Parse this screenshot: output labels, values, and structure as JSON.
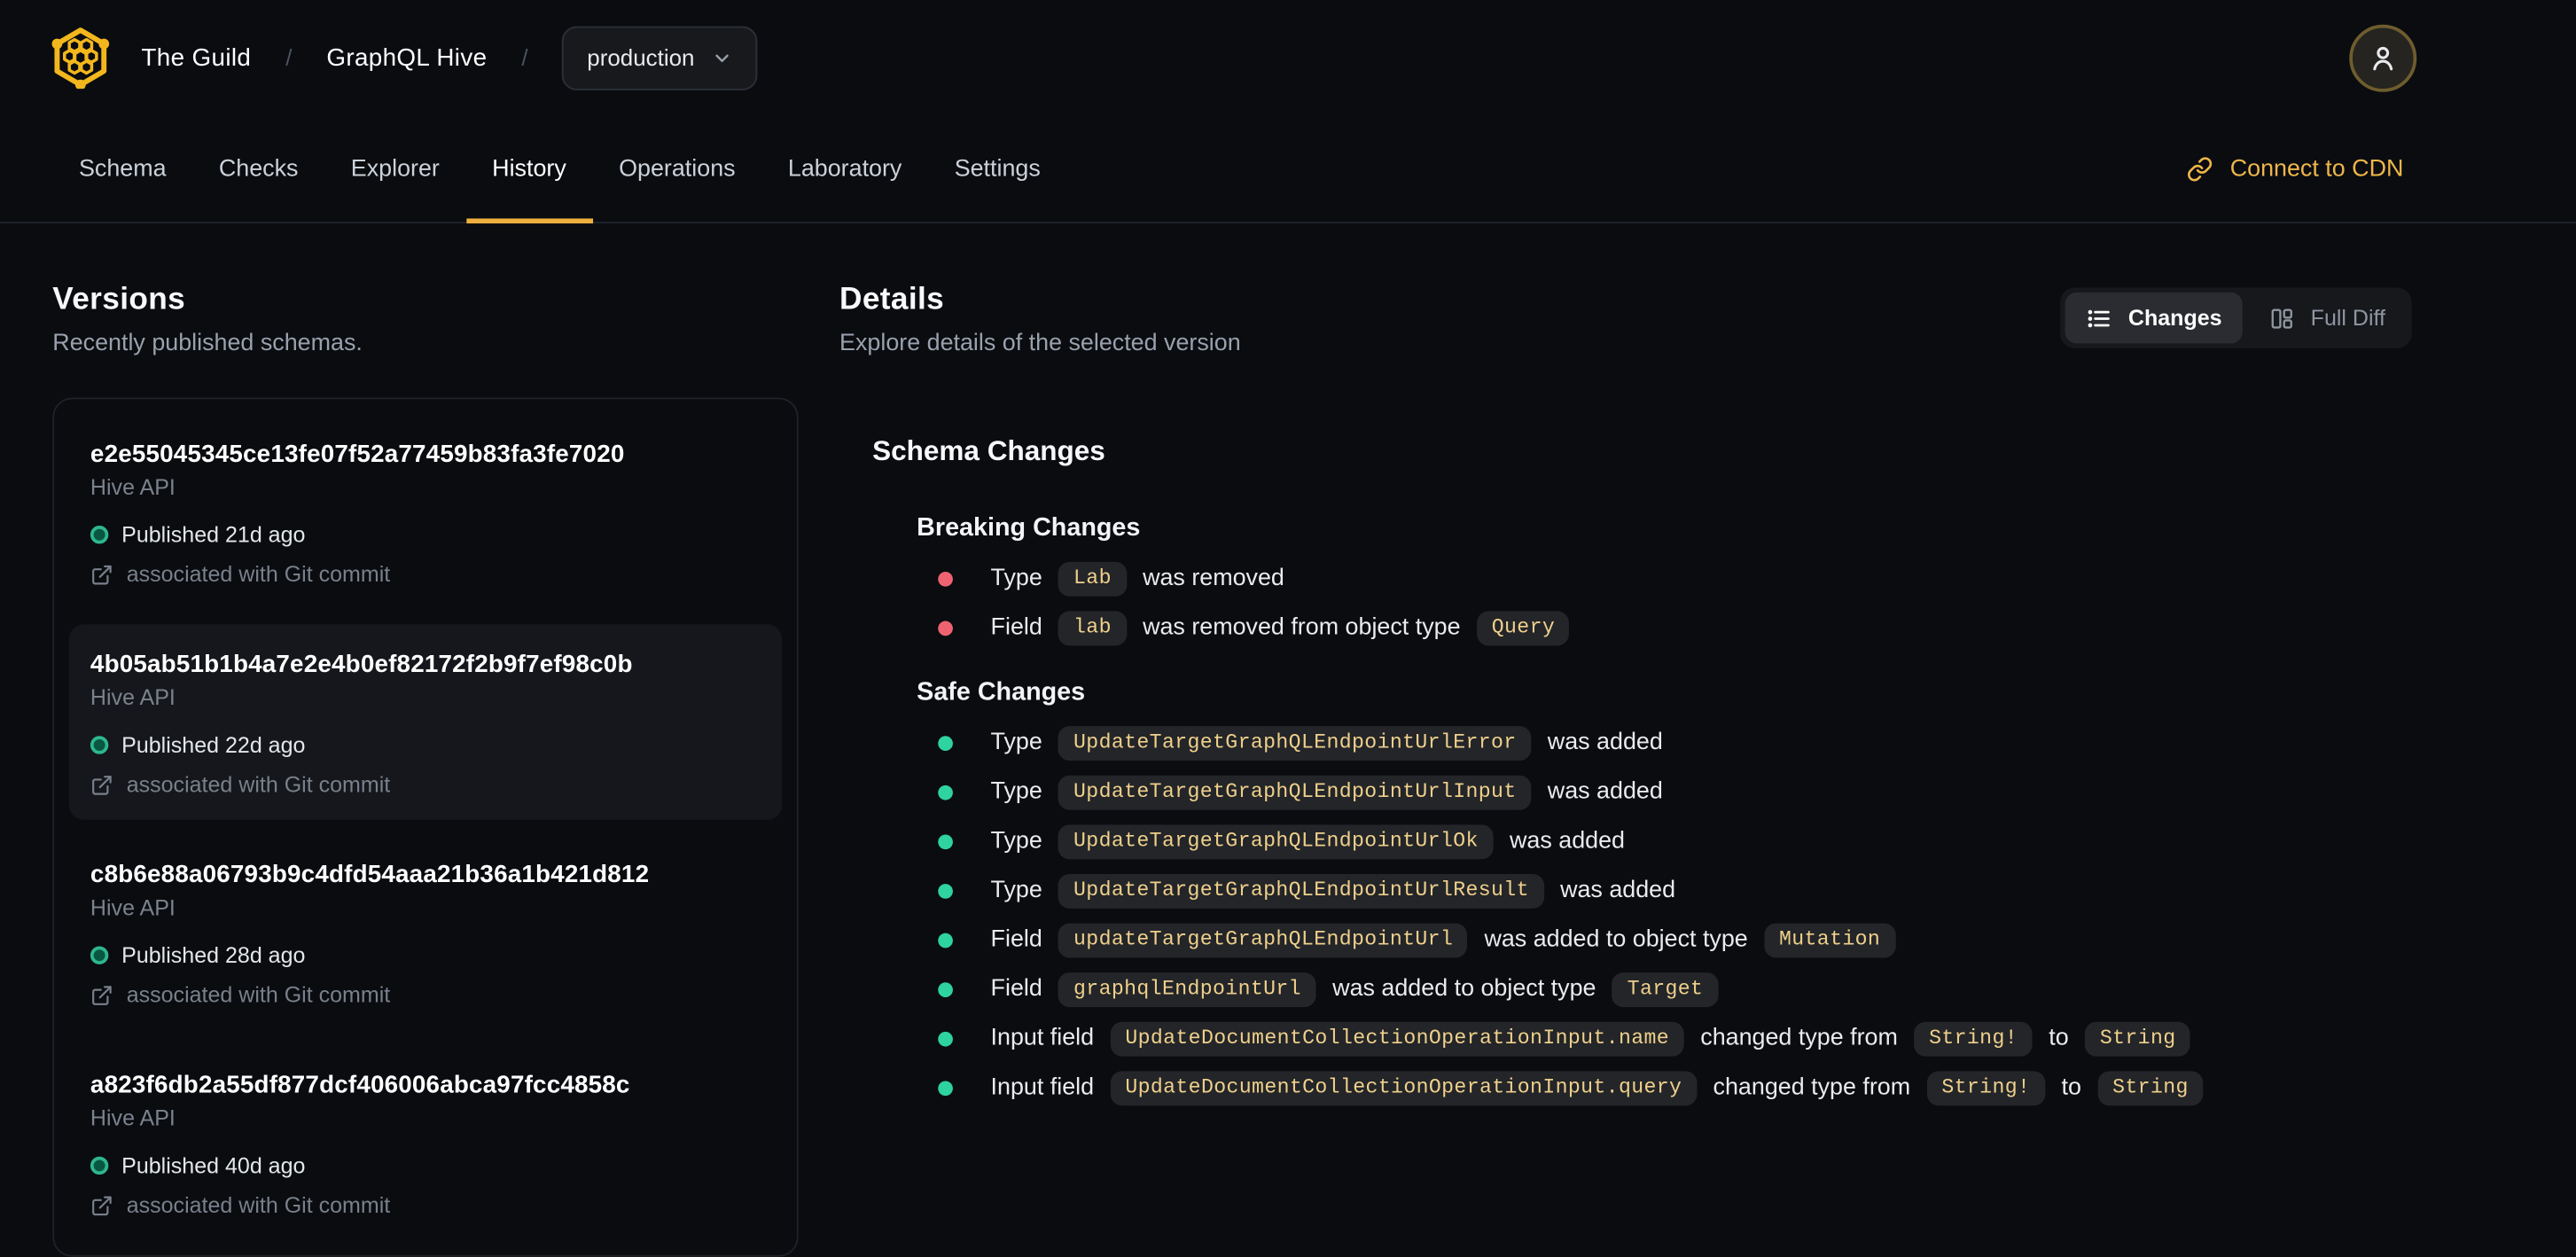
{
  "brand": {
    "org": "The Guild",
    "separator": "/",
    "project": "GraphQL Hive",
    "target": "production"
  },
  "nav": {
    "tabs": [
      {
        "label": "Schema",
        "active": false
      },
      {
        "label": "Checks",
        "active": false
      },
      {
        "label": "Explorer",
        "active": false
      },
      {
        "label": "History",
        "active": true
      },
      {
        "label": "Operations",
        "active": false
      },
      {
        "label": "Laboratory",
        "active": false
      },
      {
        "label": "Settings",
        "active": false
      }
    ],
    "cdn_label": "Connect to CDN"
  },
  "versions": {
    "title": "Versions",
    "subtitle": "Recently published schemas.",
    "items": [
      {
        "hash": "e2e55045345ce13fe07f52a77459b83fa3fe7020",
        "service": "Hive API",
        "published": "Published 21d ago",
        "git": "associated with Git commit",
        "selected": false
      },
      {
        "hash": "4b05ab51b1b4a7e2e4b0ef82172f2b9f7ef98c0b",
        "service": "Hive API",
        "published": "Published 22d ago",
        "git": "associated with Git commit",
        "selected": true
      },
      {
        "hash": "c8b6e88a06793b9c4dfd54aaa21b36a1b421d812",
        "service": "Hive API",
        "published": "Published 28d ago",
        "git": "associated with Git commit",
        "selected": false
      },
      {
        "hash": "a823f6db2a55df877dcf406006abca97fcc4858c",
        "service": "Hive API",
        "published": "Published 40d ago",
        "git": "associated with Git commit",
        "selected": false
      }
    ]
  },
  "details": {
    "title": "Details",
    "subtitle": "Explore details of the selected version",
    "view_toggle": {
      "changes_label": "Changes",
      "full_diff_label": "Full Diff"
    },
    "schema_changes_title": "Schema Changes",
    "breaking": {
      "title": "Breaking Changes",
      "items": [
        [
          {
            "kind": "text",
            "text": "Type"
          },
          {
            "kind": "code",
            "text": "Lab"
          },
          {
            "kind": "text",
            "text": "was removed"
          }
        ],
        [
          {
            "kind": "text",
            "text": "Field"
          },
          {
            "kind": "code",
            "text": "lab"
          },
          {
            "kind": "text",
            "text": "was removed from object type"
          },
          {
            "kind": "code",
            "text": "Query"
          }
        ]
      ]
    },
    "safe": {
      "title": "Safe Changes",
      "items": [
        [
          {
            "kind": "text",
            "text": "Type"
          },
          {
            "kind": "code",
            "text": "UpdateTargetGraphQLEndpointUrlError"
          },
          {
            "kind": "text",
            "text": "was added"
          }
        ],
        [
          {
            "kind": "text",
            "text": "Type"
          },
          {
            "kind": "code",
            "text": "UpdateTargetGraphQLEndpointUrlInput"
          },
          {
            "kind": "text",
            "text": "was added"
          }
        ],
        [
          {
            "kind": "text",
            "text": "Type"
          },
          {
            "kind": "code",
            "text": "UpdateTargetGraphQLEndpointUrlOk"
          },
          {
            "kind": "text",
            "text": "was added"
          }
        ],
        [
          {
            "kind": "text",
            "text": "Type"
          },
          {
            "kind": "code",
            "text": "UpdateTargetGraphQLEndpointUrlResult"
          },
          {
            "kind": "text",
            "text": "was added"
          }
        ],
        [
          {
            "kind": "text",
            "text": "Field"
          },
          {
            "kind": "code",
            "text": "updateTargetGraphQLEndpointUrl"
          },
          {
            "kind": "text",
            "text": "was added to object type"
          },
          {
            "kind": "code",
            "text": "Mutation"
          }
        ],
        [
          {
            "kind": "text",
            "text": "Field"
          },
          {
            "kind": "code",
            "text": "graphqlEndpointUrl"
          },
          {
            "kind": "text",
            "text": "was added to object type"
          },
          {
            "kind": "code",
            "text": "Target"
          }
        ],
        [
          {
            "kind": "text",
            "text": "Input field"
          },
          {
            "kind": "code",
            "text": "UpdateDocumentCollectionOperationInput.name"
          },
          {
            "kind": "text",
            "text": "changed type from"
          },
          {
            "kind": "code",
            "text": "String!"
          },
          {
            "kind": "text",
            "text": "to"
          },
          {
            "kind": "code",
            "text": "String"
          }
        ],
        [
          {
            "kind": "text",
            "text": "Input field"
          },
          {
            "kind": "code",
            "text": "UpdateDocumentCollectionOperationInput.query"
          },
          {
            "kind": "text",
            "text": "changed type from"
          },
          {
            "kind": "code",
            "text": "String!"
          },
          {
            "kind": "text",
            "text": "to"
          },
          {
            "kind": "code",
            "text": "String"
          }
        ]
      ]
    }
  },
  "icons": {
    "logo": "hive-hexagon-logo",
    "target_chevron": "chevron-down",
    "avatar": "user-person",
    "cdn": "chain-link",
    "published": "status-dot",
    "git": "external-link",
    "changes_view": "bullet-list",
    "full_diff_view": "split-columns"
  },
  "colors": {
    "background": "#0a0c10",
    "accent_amber": "#f0b03f",
    "breaking_bullet": "#ef6370",
    "safe_bullet": "#2ed3a0",
    "published_dot": "#2eb78f",
    "chip_text": "#efd08b",
    "chip_background": "#232529"
  }
}
